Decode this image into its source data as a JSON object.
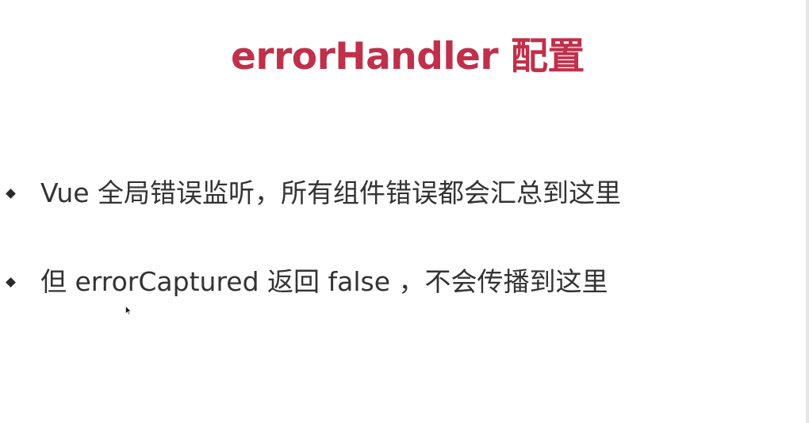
{
  "slide": {
    "title": "errorHandler 配置",
    "bullets": [
      {
        "text": "Vue 全局错误监听，所有组件错误都会汇总到这里"
      },
      {
        "text": "但 errorCaptured 返回 false ，不会传播到这里"
      }
    ]
  },
  "colors": {
    "title": "#c0304a",
    "text": "#333333",
    "bullet_marker": "#2a2a2a",
    "background": "#ffffff"
  },
  "icons": {
    "bullet_marker": "diamond-bullet-icon",
    "pointer": "mouse-pointer-icon"
  }
}
